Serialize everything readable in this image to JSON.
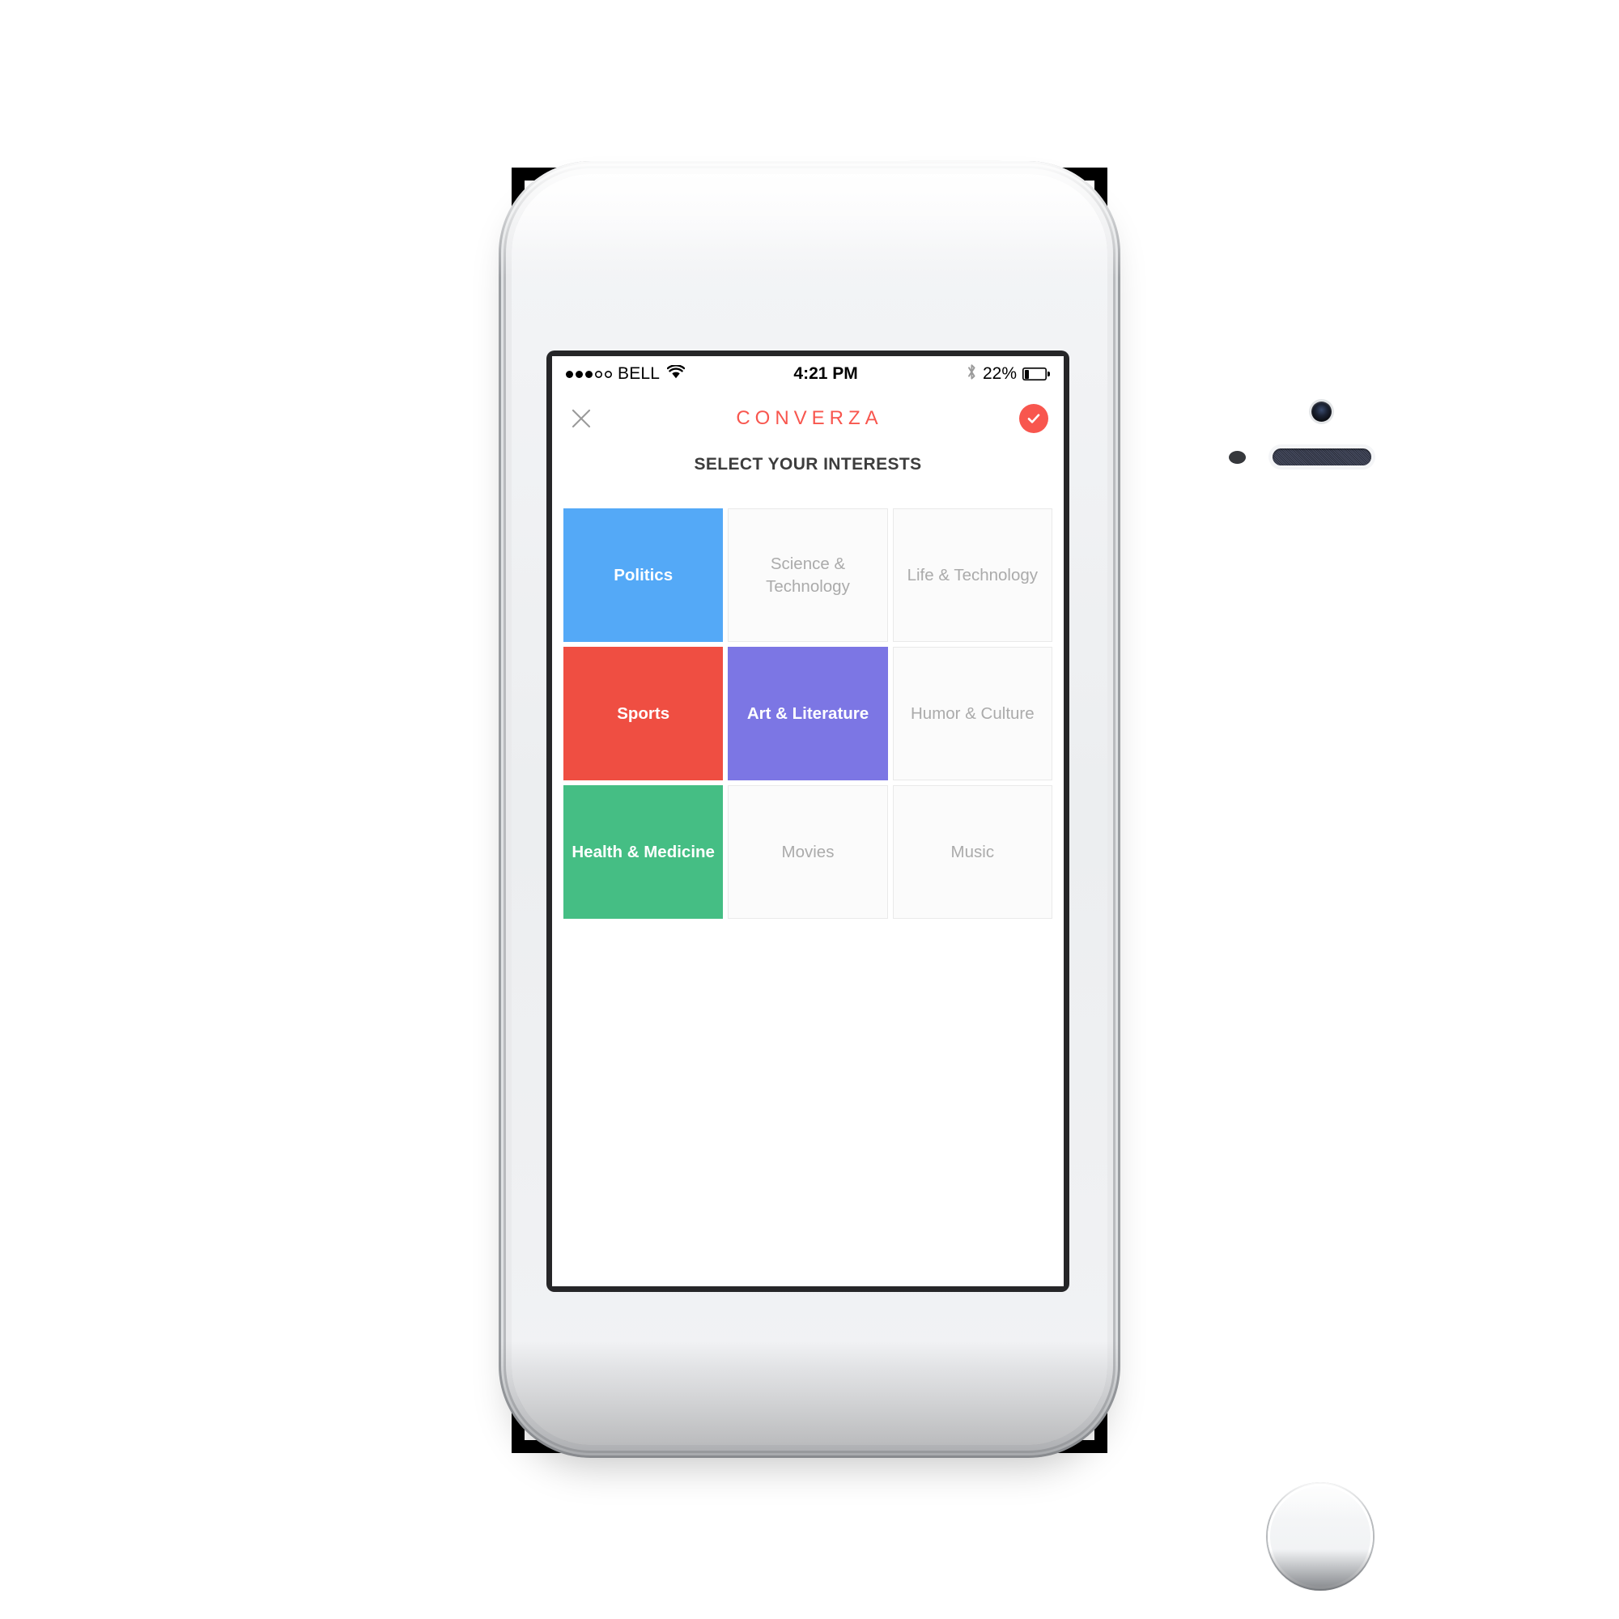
{
  "status_bar": {
    "signal_dots_filled": 3,
    "signal_dots_total": 5,
    "carrier": "BELL",
    "wifi_icon": "wifi-icon",
    "time": "4:21 PM",
    "bluetooth_icon": "bluetooth-icon",
    "battery_percent": "22%",
    "battery_level": 22
  },
  "header": {
    "close_icon": "close-x-icon",
    "brand_title": "CONVERZA",
    "confirm_icon": "checkmark-icon"
  },
  "page": {
    "subtitle": "SELECT YOUR INTERESTS"
  },
  "colors": {
    "brand_red": "#F8564E",
    "politics_blue": "#54A9F7",
    "sports_red": "#EF4E42",
    "art_purple": "#7C76E4",
    "health_green": "#45BE84",
    "unselected_bg": "#FBFBFB",
    "unselected_border": "#E9E9E9",
    "unselected_text": "#ABABAB"
  },
  "interests": [
    {
      "label": "Politics",
      "selected": true,
      "color": "#54A9F7"
    },
    {
      "label": "Science & Technology",
      "selected": false,
      "color": ""
    },
    {
      "label": "Life & Technology",
      "selected": false,
      "color": ""
    },
    {
      "label": "Sports",
      "selected": true,
      "color": "#EF4E42"
    },
    {
      "label": "Art & Literature",
      "selected": true,
      "color": "#7C76E4"
    },
    {
      "label": "Humor & Culture",
      "selected": false,
      "color": ""
    },
    {
      "label": "Health & Medicine",
      "selected": true,
      "color": "#45BE84"
    },
    {
      "label": "Movies",
      "selected": false,
      "color": ""
    },
    {
      "label": "Music",
      "selected": false,
      "color": ""
    }
  ],
  "device": {
    "power_button": "power-button",
    "silent_switch": "silent-switch",
    "volume_up": "volume-up-button",
    "volume_down": "volume-down-button",
    "home_button": "home-button",
    "camera": "front-camera",
    "earpiece": "earpiece-speaker",
    "proximity_sensor": "proximity-sensor"
  }
}
